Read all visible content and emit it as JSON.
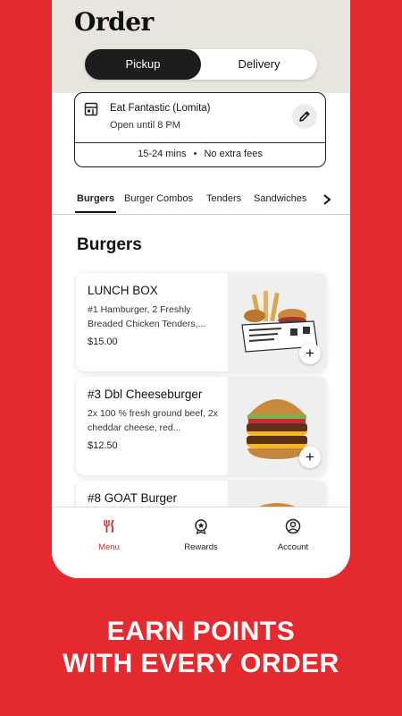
{
  "header": {
    "title": "Order"
  },
  "order_mode": {
    "options": [
      "Pickup",
      "Delivery"
    ],
    "selected": "Pickup"
  },
  "store": {
    "name": "Eat Fantastic (Lomita)",
    "hours": "Open until 8 PM",
    "eta": "15-24 mins",
    "fees": "No extra fees",
    "store_icon": "storefront-icon",
    "edit_icon": "pencil-icon"
  },
  "categories": {
    "tabs": [
      "Burgers",
      "Burger Combos",
      "Tenders",
      "Sandwiches"
    ],
    "active": "Burgers",
    "more_icon": "chevron-right-icon"
  },
  "menu": {
    "section_title": "Burgers",
    "items": [
      {
        "name": "LUNCH BOX",
        "description": "#1 Hamburger, 2 Freshly Breaded Chicken Tenders,...",
        "price": "$15.00"
      },
      {
        "name": "#3 Dbl Cheeseburger",
        "description": "2x 100 % fresh ground beef, 2x cheddar cheese, red...",
        "price": "$12.50"
      },
      {
        "name": "#8 GOAT Burger"
      }
    ],
    "add_icon": "plus-icon"
  },
  "bottom_nav": [
    {
      "label": "Menu",
      "icon": "fork-knife-icon",
      "active": true
    },
    {
      "label": "Rewards",
      "icon": "medal-icon",
      "active": false
    },
    {
      "label": "Account",
      "icon": "user-icon",
      "active": false
    }
  ],
  "promo": {
    "line1": "EARN POINTS",
    "line2": "WITH EVERY ORDER"
  },
  "colors": {
    "brand_red": "#e42a2f",
    "header_bg": "#e8e5df",
    "toggle_active": "#1d1d1d"
  }
}
